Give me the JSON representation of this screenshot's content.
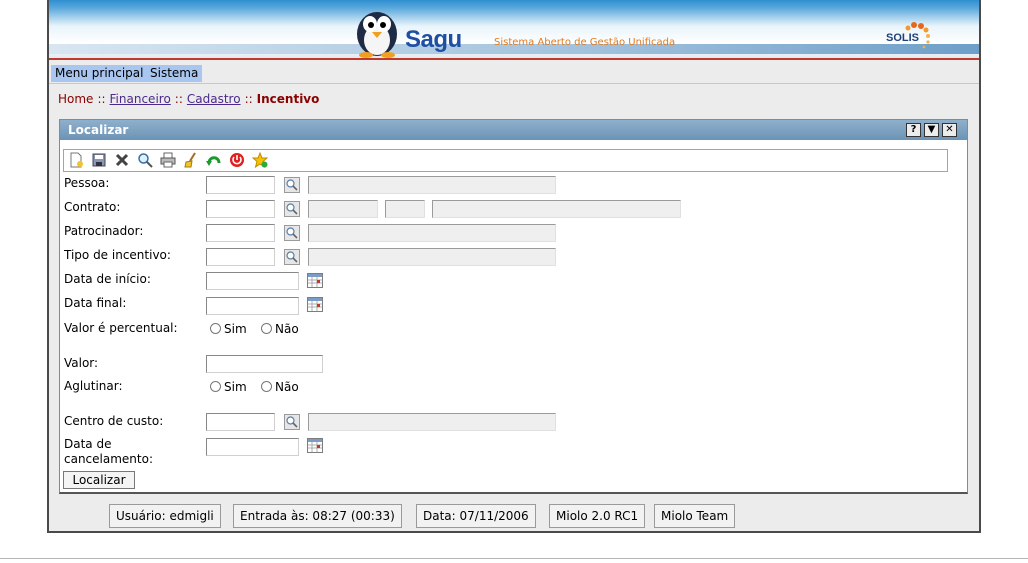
{
  "banner": {
    "app_name": "Sagu",
    "subtitle": "Sistema Aberto de Gestão Unificada",
    "partner_logo": "SOLIS"
  },
  "menu": {
    "items": [
      {
        "label": "Menu principal"
      },
      {
        "label": "Sistema"
      }
    ]
  },
  "breadcrumb": {
    "home": "Home",
    "separator": "::",
    "items": [
      "Financeiro",
      "Cadastro"
    ],
    "current": "Incentivo"
  },
  "panel": {
    "title": "Localizar",
    "window_buttons": [
      "?",
      "▼",
      "✕"
    ]
  },
  "toolbar": {
    "icons": [
      "new-icon",
      "save-icon",
      "delete-icon",
      "search-icon",
      "print-icon",
      "clear-icon",
      "back-icon",
      "exit-icon",
      "favorite-icon"
    ]
  },
  "form": {
    "pessoa_label": "Pessoa:",
    "contrato_label": "Contrato:",
    "patrocinador_label": "Patrocinador:",
    "tipo_incentivo_label": "Tipo de incentivo:",
    "data_inicio_label": "Data de início:",
    "data_final_label": "Data final:",
    "valor_percentual_label": "Valor é percentual:",
    "valor_label": "Valor:",
    "aglutinar_label": "Aglutinar:",
    "centro_custo_label": "Centro de custo:",
    "data_cancelamento_label": "Data de cancelamento:",
    "sim": "Sim",
    "nao": "Não",
    "submit": "Localizar"
  },
  "status": {
    "user": "Usuário: edmigli",
    "entry": "Entrada às: 08:27 (00:33)",
    "date": "Data: 07/11/2006",
    "version": "Miolo 2.0 RC1",
    "team": "Miolo Team"
  },
  "colors": {
    "title_bar": "#7a9dbd",
    "menu_item": "#a9c6f0",
    "breadcrumb": "#8b0000",
    "accent_line": "#c0392b"
  }
}
